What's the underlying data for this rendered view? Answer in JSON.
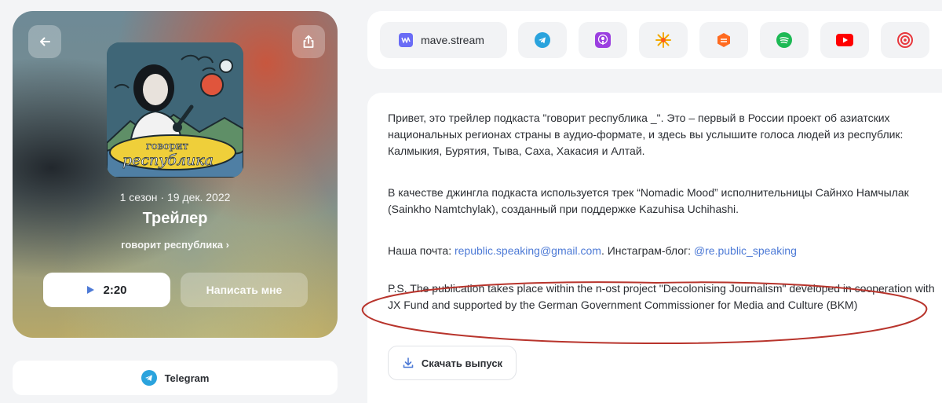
{
  "episode": {
    "season_date": "1 сезон · 19 дек. 2022",
    "title": "Трейлер",
    "show_name": "говорит республика",
    "show_chevron": "›",
    "duration": "2:20",
    "message_label": "Написать мне",
    "cover_logo_text": [
      "говорит",
      "республика"
    ]
  },
  "telegram_bar": {
    "label": "Telegram"
  },
  "platforms": {
    "mave_label": "mave.stream",
    "icons": [
      "telegram-icon",
      "apple-podcasts-icon",
      "yandex-music-icon",
      "zvuk-icon",
      "spotify-icon",
      "youtube-icon",
      "castbox-icon"
    ]
  },
  "description": {
    "p1": "Привет, это трейлер подкаста \"говорит республика _\". Это – первый в России проект об азиатских национальных регионах страны в аудио-формате, и здесь вы услышите голоса людей из республик: Калмыкия, Бурятия, Тыва, Саха, Хакасия и Алтай.",
    "p2": "В качестве джингла подкаста используется трек “Nomadic Mood” исполнительницы Сайнхо Намчылак (Sainkho Namtchylak), созданный при поддержке Kazuhisa Uchihashi.",
    "p3_prefix": "Наша почта: ",
    "email": "republic.speaking@gmail.com",
    "p3_middle": ". Инстаграм-блог: ",
    "instagram": "@re.public_speaking",
    "p4": "P.S. The publication takes place within the n-ost project \"Decolonising Journalism\" developed in cooperation with JX Fund and supported by the German Government Commissioner for Media and Culture (BKM)",
    "download_label": "Скачать выпуск"
  },
  "colors": {
    "accent_blue": "#4d7ad6",
    "annotation_red": "#b8342c",
    "mave_purple": "#6a6cf6",
    "telegram_blue": "#2aa3dd"
  }
}
